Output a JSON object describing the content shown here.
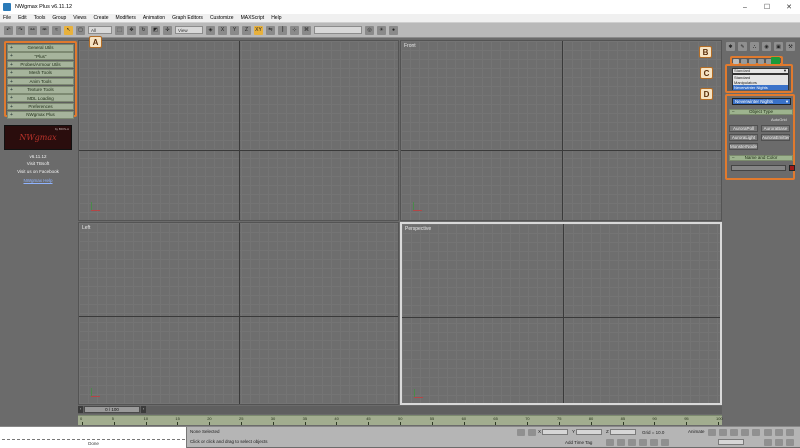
{
  "window": {
    "title": "NWgmax Plus v6.11.12",
    "controls": [
      "–",
      "☐",
      "✕"
    ]
  },
  "menu": [
    "File",
    "Edit",
    "Tools",
    "Group",
    "Views",
    "Create",
    "Modifiers",
    "Animation",
    "Graph Editors",
    "Customize",
    "MAXScript",
    "Help"
  ],
  "toolbar": {
    "selection_filter": "All",
    "reference_coord": "View",
    "named_selection": ""
  },
  "plugin_panel": {
    "buttons": [
      "General Utils",
      "\"Plus\"",
      "Probes/Armour Utils",
      "Mesh Tools",
      "Anim Tools",
      "Texture Tools",
      "MDL Loading",
      "Preferences",
      "NWgmax Plus"
    ],
    "logo_subtitle": "by BIOS-A",
    "logo_text": "NWgmax",
    "version": "v6.11.12",
    "visit": "Visit TBsoft",
    "facebook": "Visit us on Facebook",
    "help": "NWgmax Help"
  },
  "callouts": [
    "A",
    "B",
    "C",
    "D"
  ],
  "viewports": [
    {
      "label": "",
      "active": false
    },
    {
      "label": "Front",
      "active": false
    },
    {
      "label": "Left",
      "active": false
    },
    {
      "label": "Perspective",
      "active": true
    }
  ],
  "command_panel": {
    "category_dropdown_value": "Standard",
    "category_options": [
      "Standard",
      "Manipulators",
      "Neverwinter Nights"
    ],
    "selected_category": "Neverwinter Nights",
    "object_set": "Neverwinter Nights",
    "object_type_header": "Object Type",
    "autogrid": "AutoGrid",
    "object_buttons": [
      "AuroraPoll",
      "AuroraBase",
      "AuroraLight",
      "AuroraEmitter",
      "MonsterNode"
    ],
    "name_color_header": "Name and Color",
    "swatch_color": "#a01818"
  },
  "timeline": {
    "frame_display": "0 / 100",
    "ticks": [
      0,
      5,
      10,
      15,
      20,
      25,
      30,
      35,
      40,
      45,
      50,
      55,
      60,
      65,
      70,
      75,
      80,
      85,
      90,
      95,
      100
    ]
  },
  "status": {
    "done": "Done",
    "selection": "None Selected",
    "prompt": "Click or click and drag to select objects",
    "x_label": "X",
    "y_label": "Y",
    "z_label": "Z",
    "grid": "Grid = 10.0",
    "add_time_tag": "Add Time Tag",
    "animate": "Animate"
  }
}
